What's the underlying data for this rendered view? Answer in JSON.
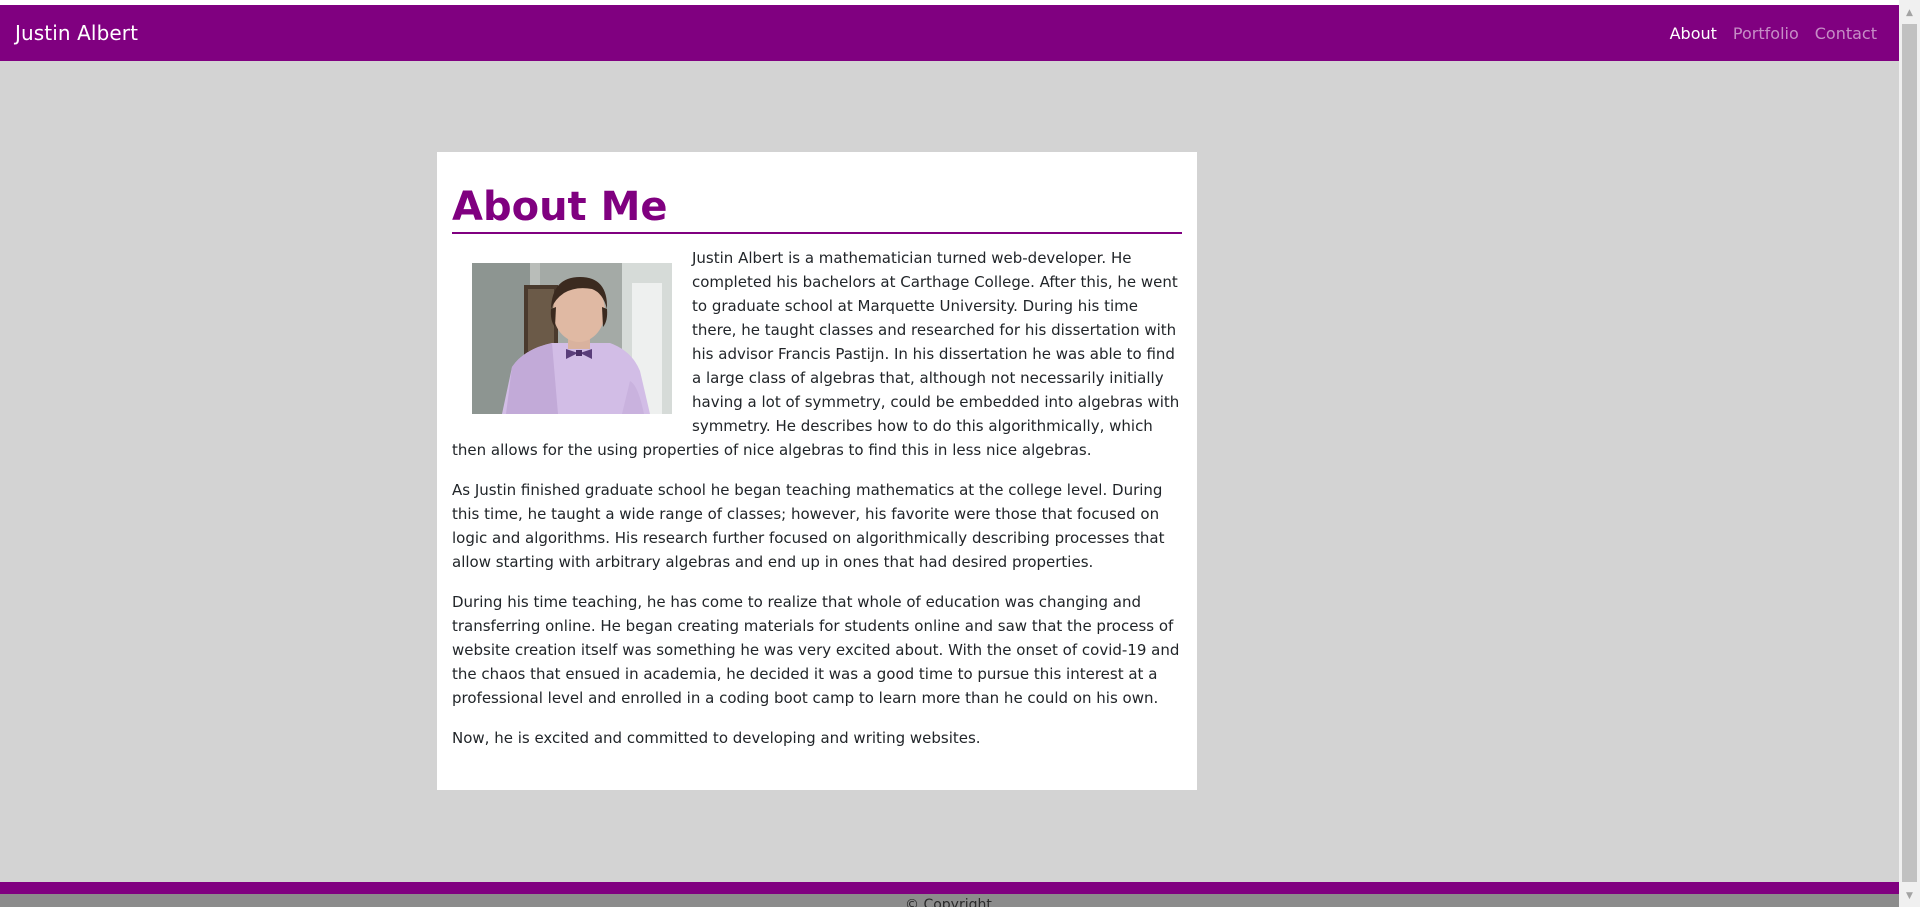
{
  "navbar": {
    "brand": "Justin Albert",
    "links": [
      {
        "label": "About",
        "active": true
      },
      {
        "label": "Portfolio",
        "active": false
      },
      {
        "label": "Contact",
        "active": false
      }
    ]
  },
  "about": {
    "title": "About Me",
    "paragraphs": [
      "Justin Albert is a mathematician turned web-developer. He completed his bachelors at Carthage College. After this, he went to graduate school at Marquette University. During his time there, he taught classes and researched for his dissertation with his advisor Francis Pastijn. In his dissertation he was able to find a large class of algebras that, although not necessarily initially having a lot of symmetry, could be embedded into algebras with symmetry. He describes how to do this algorithmically, which then allows for the using properties of nice algebras to find this in less nice algebras.",
      "As Justin finished graduate school he began teaching mathematics at the college level. During this time, he taught a wide range of classes; however, his favorite were those that focused on logic and algorithms. His research further focused on algorithmically describing processes that allow starting with arbitrary algebras and end up in ones that had desired properties.",
      "During his time teaching, he has come to realize that whole of education was changing and transferring online. He began creating materials for students online and saw that the process of website creation itself was something he was very excited about. With the onset of covid-19 and the chaos that ensued in academia, he decided it was a good time to pursue this interest at a professional level and enrolled in a coding boot camp to learn more than he could on his own.",
      "Now, he is excited and committed to developing and writing websites."
    ]
  },
  "footer": {
    "text": "© Copyright"
  },
  "colors": {
    "brand": "#800080",
    "page_background": "#d3d3d3",
    "card_background": "#ffffff"
  }
}
